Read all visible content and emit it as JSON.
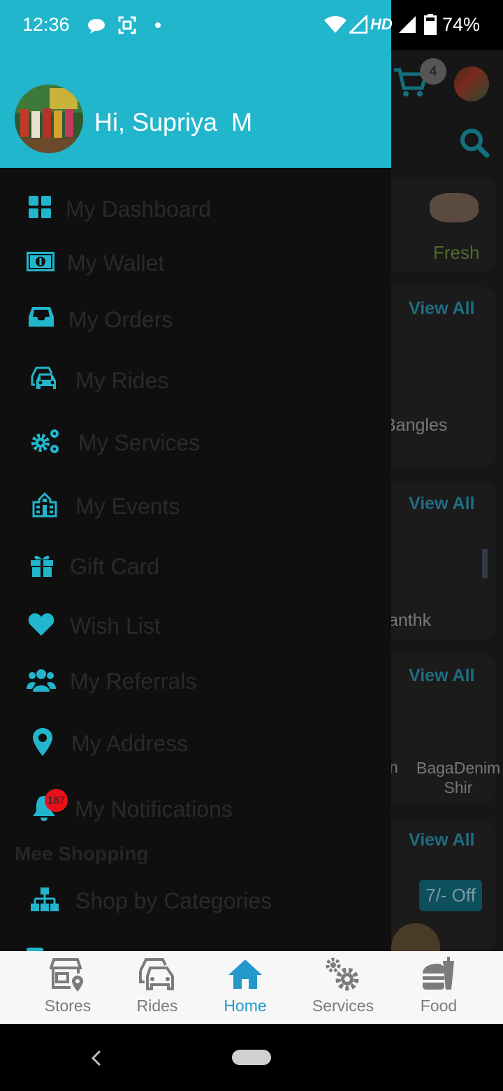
{
  "status_bar": {
    "time": "12:36",
    "network": "HD",
    "battery": "74%"
  },
  "background": {
    "cart_count": "4",
    "fresh_label": "Fresh",
    "view_all_label": "View All",
    "bangles_label": "Bangles",
    "anthk_label": "anthk",
    "product_left": "n",
    "product_right": "BagaDenim Shir",
    "offer_badge": "7/- Off"
  },
  "drawer": {
    "greeting": "Hi, Supriya  M",
    "items": [
      {
        "label": "My Dashboard",
        "icon": "dashboard-icon"
      },
      {
        "label": "My Wallet",
        "icon": "wallet-icon"
      },
      {
        "label": "My Orders",
        "icon": "inbox-icon"
      },
      {
        "label": "My Rides",
        "icon": "car-icon"
      },
      {
        "label": "My Services",
        "icon": "gears-icon"
      },
      {
        "label": "My Events",
        "icon": "building-icon"
      },
      {
        "label": "Gift Card",
        "icon": "gift-icon"
      },
      {
        "label": "Wish List",
        "icon": "heart-icon"
      },
      {
        "label": "My Referrals",
        "icon": "users-icon"
      },
      {
        "label": "My Address",
        "icon": "location-icon"
      },
      {
        "label": "My Notifications",
        "icon": "bell-icon"
      }
    ],
    "notification_count": "187",
    "section_title": "Mee Shopping",
    "shop_by_categories": "Shop by Categories"
  },
  "bottom_nav": {
    "items": [
      {
        "label": "Stores",
        "icon": "store-icon"
      },
      {
        "label": "Rides",
        "icon": "car-icon"
      },
      {
        "label": "Home",
        "icon": "home-icon"
      },
      {
        "label": "Services",
        "icon": "gears-icon"
      },
      {
        "label": "Food",
        "icon": "food-icon"
      }
    ],
    "active": "Home"
  },
  "colors": {
    "accent": "#22b6cd",
    "nav_active": "#2398c9",
    "nav_inactive": "#7b7b7b",
    "badge": "#e8111b"
  }
}
